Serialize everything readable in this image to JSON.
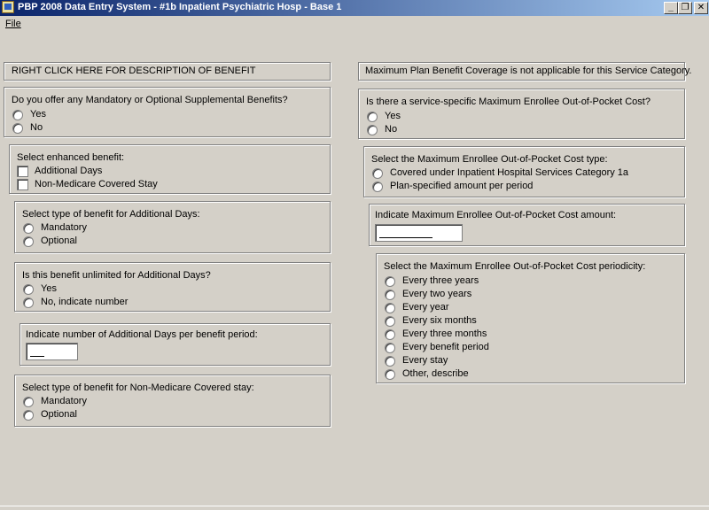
{
  "window": {
    "title": "PBP 2008 Data Entry System - #1b Inpatient Psychiatric Hosp - Base 1",
    "app_icon": "form-icon",
    "controls": {
      "minimize": "_",
      "restore": "❐",
      "close": "✕"
    }
  },
  "menu": {
    "file": "File"
  },
  "left": {
    "description_banner": "RIGHT CLICK HERE FOR DESCRIPTION OF BENEFIT",
    "supplemental": {
      "question": "Do you offer any Mandatory or Optional Supplemental Benefits?",
      "options": [
        "Yes",
        "No"
      ]
    },
    "enhanced": {
      "question": "Select enhanced benefit:",
      "options": [
        "Additional Days",
        "Non-Medicare Covered Stay"
      ]
    },
    "additional_days_type": {
      "question": "Select type of benefit for Additional Days:",
      "options": [
        "Mandatory",
        "Optional"
      ]
    },
    "unlimited": {
      "question": "Is this benefit unlimited for Additional Days?",
      "options": [
        "Yes",
        "No, indicate number"
      ]
    },
    "additional_days_number": {
      "question": "Indicate number of Additional Days per benefit period:",
      "value": ""
    },
    "non_medicare_type": {
      "question": "Select type of benefit for Non-Medicare Covered stay:",
      "options": [
        "Mandatory",
        "Optional"
      ]
    }
  },
  "right": {
    "max_plan_note": "Maximum Plan Benefit Coverage is not applicable for this Service Category.",
    "oop_specific": {
      "question": "Is there a service-specific Maximum Enrollee Out-of-Pocket Cost?",
      "options": [
        "Yes",
        "No"
      ]
    },
    "oop_type": {
      "question": "Select the Maximum Enrollee Out-of-Pocket Cost type:",
      "options": [
        "Covered under Inpatient Hospital Services Category 1a",
        "Plan-specified amount per period"
      ]
    },
    "oop_amount": {
      "question": "Indicate Maximum Enrollee Out-of-Pocket Cost amount:",
      "value": ""
    },
    "oop_periodicity": {
      "question": "Select the Maximum Enrollee Out-of-Pocket Cost periodicity:",
      "options": [
        "Every three years",
        "Every two years",
        "Every year",
        "Every six months",
        "Every three months",
        "Every benefit period",
        "Every stay",
        "Other, describe"
      ]
    }
  }
}
